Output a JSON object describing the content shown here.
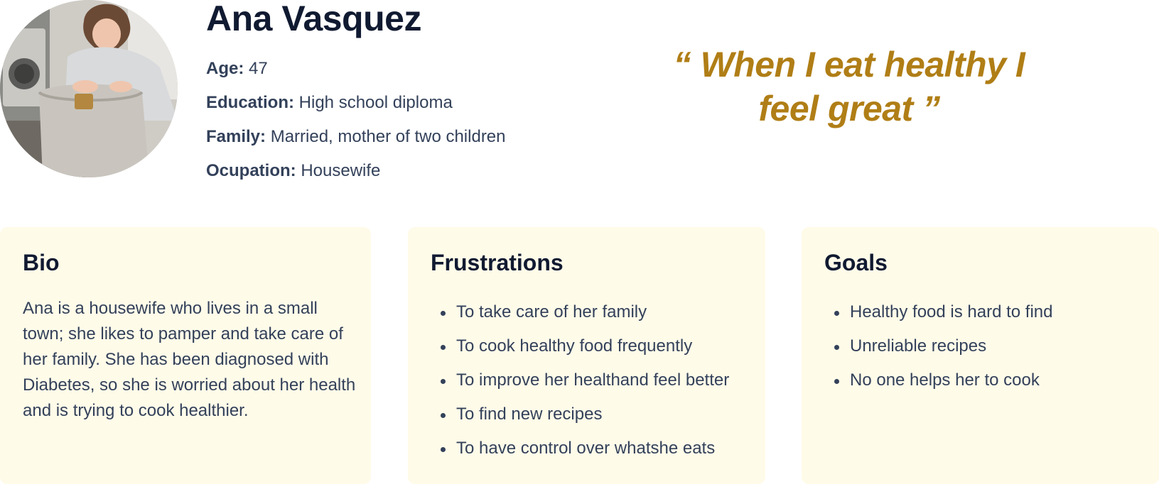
{
  "persona": {
    "name": "Ana Vasquez",
    "photo_icon": "persona-photo",
    "details": [
      {
        "label": "Age:",
        "value": "47"
      },
      {
        "label": "Education:",
        "value": "High school diploma"
      },
      {
        "label": "Family:",
        "value": "Married, mother of two children"
      },
      {
        "label": "Ocupation:",
        "value": "Housewife"
      }
    ],
    "quote": "“ When I eat healthy I feel great ”"
  },
  "bio": {
    "title": "Bio",
    "text": "Ana is a housewife who lives in a small town; she likes to pamper and take care of her family. She has been diagnosed with Diabetes, so she is worried about her health and is trying to cook healthier."
  },
  "frustrations": {
    "title": "Frustrations",
    "items": [
      "To take care of her family",
      "To cook healthy food frequently",
      "To improve her healthand feel better",
      "To find new recipes",
      "To have control over whatshe eats"
    ]
  },
  "goals": {
    "title": "Goals",
    "items": [
      "Healthy food is hard to find",
      "Unreliable recipes",
      "No one helps her to cook"
    ]
  },
  "colors": {
    "quote": "#b07e16",
    "card_bg": "#fffbe9",
    "heading": "#101a31",
    "body_text": "#33415a"
  }
}
